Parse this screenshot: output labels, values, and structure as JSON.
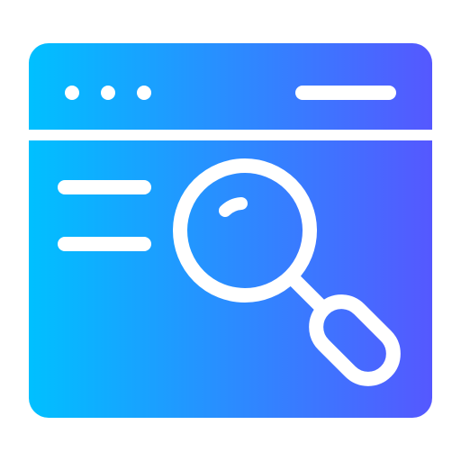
{
  "icon": {
    "name": "browser-search-icon",
    "gradient_start": "#00C0FF",
    "gradient_end": "#5558FF",
    "line_color": "#FFFFFF"
  },
  "window": {
    "dots": [
      "dot-1",
      "dot-2",
      "dot-3"
    ],
    "address_bar_icon": "line-icon",
    "content_lines": [
      "text-line-1",
      "text-line-2"
    ]
  },
  "magnifier": {
    "icon": "magnifying-glass-icon"
  }
}
